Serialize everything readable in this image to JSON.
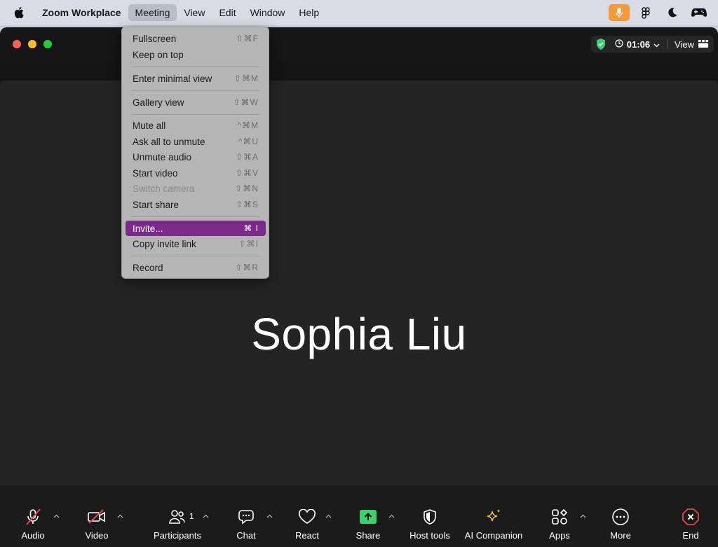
{
  "menubar": {
    "app_name": "Zoom Workplace",
    "items": [
      {
        "label": "Meeting"
      },
      {
        "label": "View"
      },
      {
        "label": "Edit"
      },
      {
        "label": "Window"
      },
      {
        "label": "Help"
      }
    ],
    "active_menu": "Meeting",
    "status_icons": [
      "microphone-icon",
      "figma-icon",
      "moon-icon",
      "gamepad-icon"
    ]
  },
  "window": {
    "timer": "01:06",
    "view_label": "View"
  },
  "meeting_menu": {
    "items": [
      {
        "label": "Fullscreen",
        "shortcut": "⇧⌘F"
      },
      {
        "label": "Keep on top",
        "shortcut": ""
      },
      {
        "label": "Enter minimal view",
        "shortcut": "⇧⌘M"
      },
      {
        "label": "Gallery view",
        "shortcut": "⇧⌘W"
      },
      {
        "label": "Mute all",
        "shortcut": "^⌘M"
      },
      {
        "label": "Ask all to unmute",
        "shortcut": "^⌘U"
      },
      {
        "label": "Unmute audio",
        "shortcut": "⇧⌘A"
      },
      {
        "label": "Start video",
        "shortcut": "⇧⌘V"
      },
      {
        "label": "Switch camera",
        "shortcut": "⇧⌘N",
        "disabled": true
      },
      {
        "label": "Start share",
        "shortcut": "⇧⌘S"
      },
      {
        "label": "Invite...",
        "shortcut": "⌘ I",
        "selected": true
      },
      {
        "label": "Copy invite link",
        "shortcut": "⇧⌘I"
      },
      {
        "label": "Record",
        "shortcut": "⇧⌘R"
      }
    ]
  },
  "participant": {
    "name": "Sophia Liu"
  },
  "toolbar": {
    "audio": "Audio",
    "video": "Video",
    "participants": "Participants",
    "participants_count": "1",
    "chat": "Chat",
    "react": "React",
    "share": "Share",
    "host_tools": "Host tools",
    "ai_companion": "AI Companion",
    "apps": "Apps",
    "more": "More",
    "end": "End"
  },
  "colors": {
    "accent_purple": "#7b2a8c",
    "share_green": "#3ccf6e",
    "end_red": "#e5484d",
    "mic_orange": "#f39b3a",
    "ai_gold": "#e8c15a"
  }
}
